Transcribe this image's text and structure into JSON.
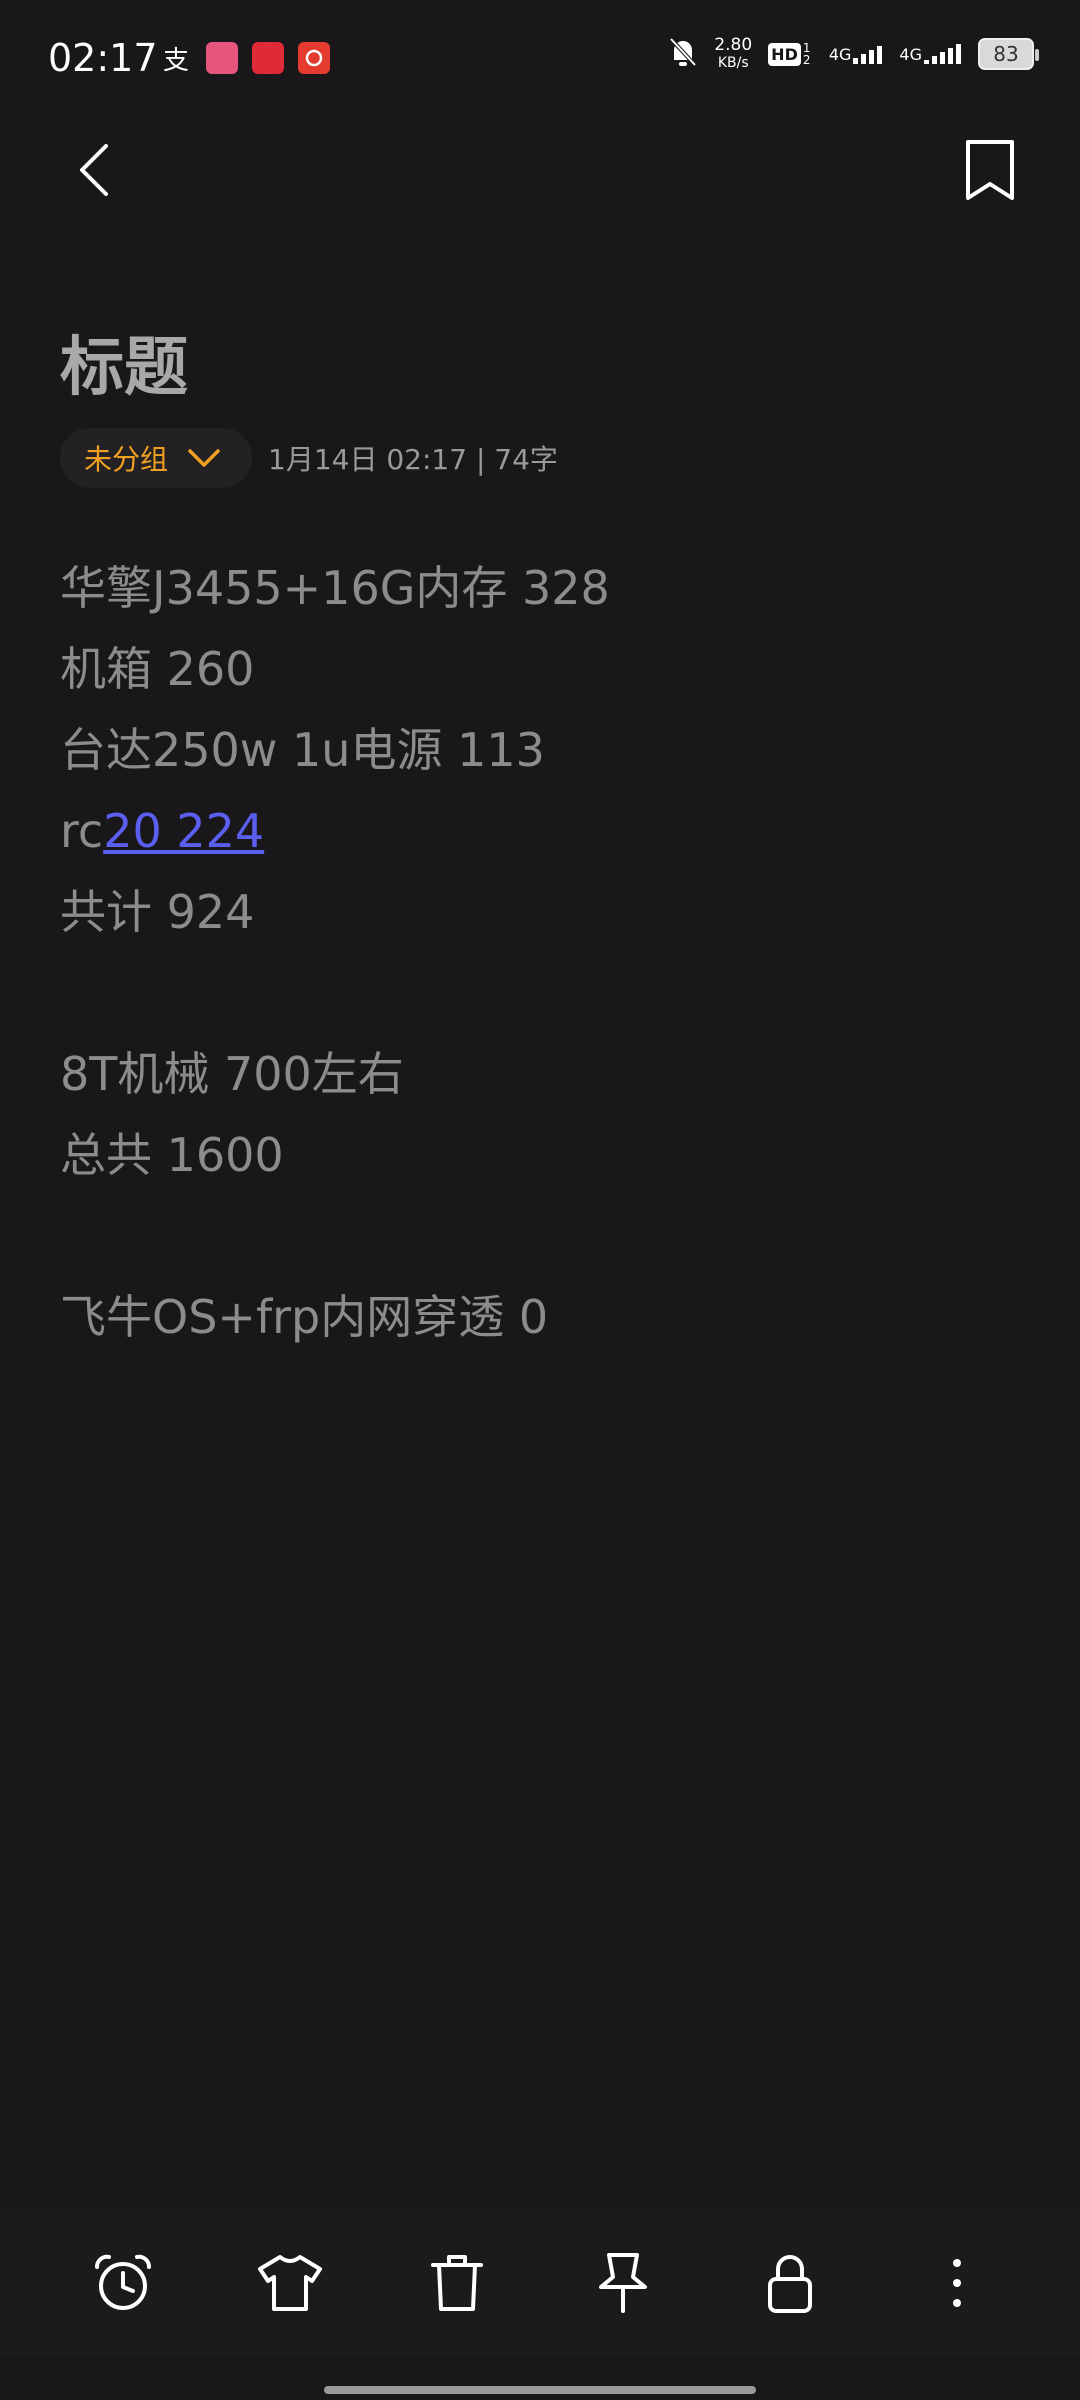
{
  "status_bar": {
    "time": "02:17",
    "net_speed_value": "2.80",
    "net_speed_unit": "KB/s",
    "hd_label": "HD",
    "hd_sub": "1 2",
    "sim1": "4G",
    "sim2": "4G",
    "battery": "83"
  },
  "header": {
    "back_icon": "back-arrow-icon",
    "bookmark_icon": "bookmark-icon"
  },
  "note": {
    "title": "标题",
    "group_label": "未分组",
    "meta": "1月14日 02:17  |  74字",
    "lines": [
      {
        "text": "华擎J3455+16G内存 328"
      },
      {
        "text": "机箱 260"
      },
      {
        "text": "台达250w 1u电源 113"
      },
      {
        "prefix": "rc",
        "link": "20 224"
      },
      {
        "text": "共计 924"
      },
      {
        "text": ""
      },
      {
        "text": "8T机械 700左右"
      },
      {
        "text": "总共 1600"
      },
      {
        "text": ""
      },
      {
        "text": "飞牛OS+frp内网穿透 0"
      }
    ]
  },
  "toolbar": {
    "items": [
      "alarm-clock-icon",
      "shirt-icon",
      "trash-icon",
      "pin-icon",
      "lock-icon",
      "more-vertical-icon"
    ]
  },
  "colors": {
    "background": "#19171a",
    "accent": "#f0a020",
    "link": "#5a5ff0",
    "text": "#8c8c8c"
  }
}
